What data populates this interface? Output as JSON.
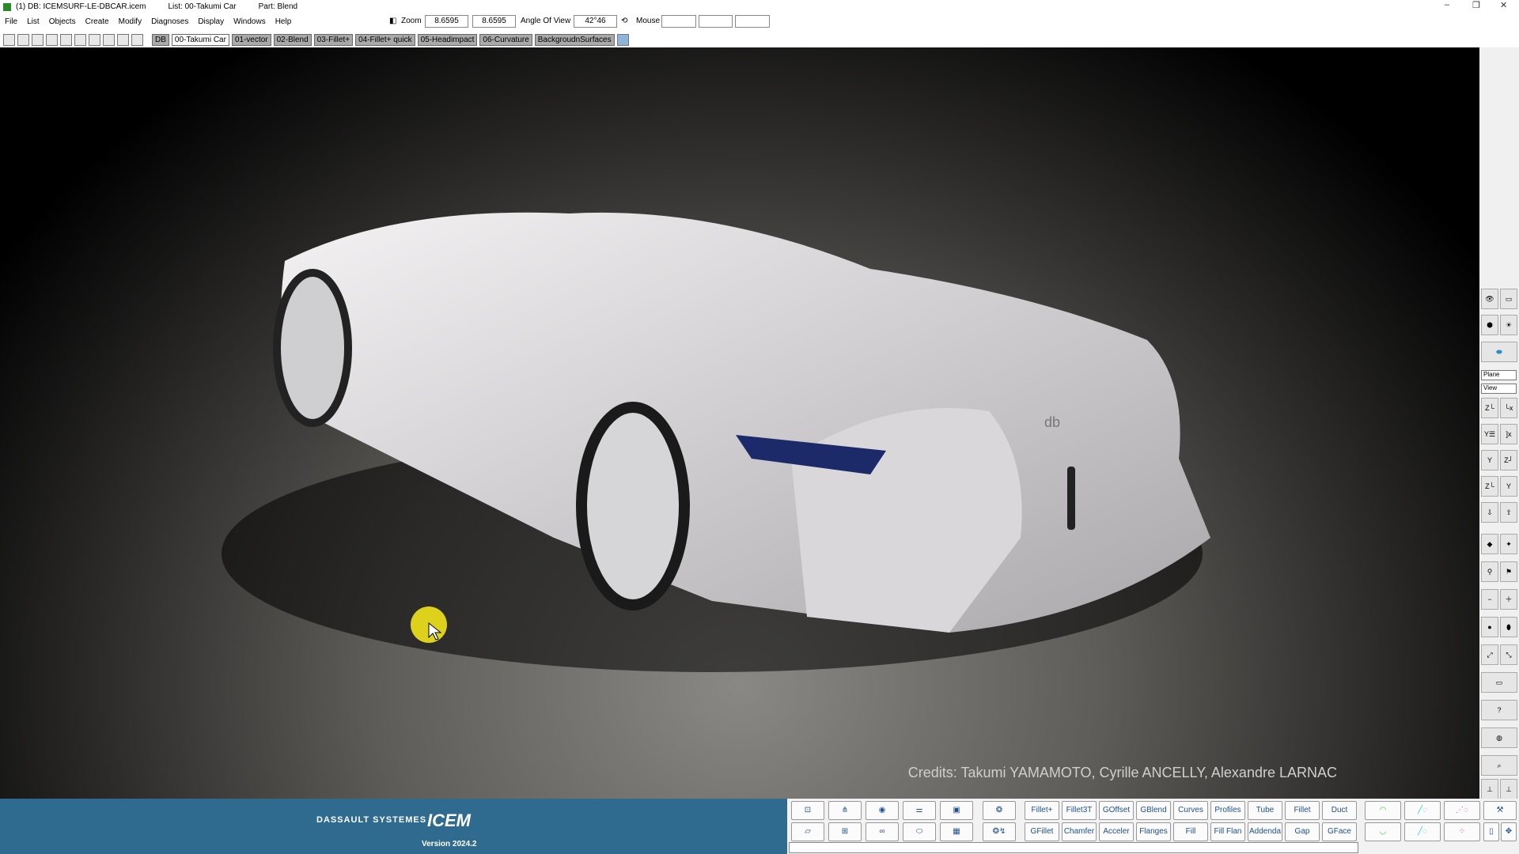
{
  "titlebar": {
    "db": "(1) DB: ICEMSURF-LE-DBCAR.icem",
    "list": "List: 00-Takumi Car",
    "part": "Part: Blend"
  },
  "menu": [
    "File",
    "List",
    "Objects",
    "Create",
    "Modify",
    "Diagnoses",
    "Display",
    "Windows",
    "Help"
  ],
  "view": {
    "zoom_label": "Zoom",
    "zoom_value": "8.6595",
    "zoom_value2": "8.6595",
    "angle_label": "Angle Of View",
    "angle_value": "42°46",
    "mouse_label": "Mouse"
  },
  "tabs": [
    "DB",
    "00-Takumi Car",
    "01-vector",
    "02-Blend",
    "03-Fillet+",
    "04-Fillet+ quick",
    "05-Headimpact",
    "06-Curvature",
    "BackgroudnSurfaces"
  ],
  "active_tab": "00-Takumi Car",
  "viewport": {
    "credits": "Credits: Takumi YAMAMOTO, Cyrille ANCELLY, Alexandre LARNAC",
    "badge": "db"
  },
  "rightbar": {
    "plane_select": "Plane",
    "view_select": "View"
  },
  "branding": {
    "company": "DASSAULT SYSTEMES",
    "product": "ICEM",
    "version": "Version 2024.2"
  },
  "buttons_row1": [
    "Fillet+",
    "Fillet3T",
    "GOffset",
    "GBlend",
    "Curves",
    "Profiles",
    "Tube",
    "Fillet",
    "Duct"
  ],
  "buttons_row2": [
    "GFillet",
    "Chamfer",
    "Acceler",
    "Flanges",
    "Fill",
    "Fill Flan",
    "Addenda",
    "Gap",
    "GFace"
  ],
  "colors": {
    "brand_panel": "#2f6a8f",
    "button_text": "#1f4f8f",
    "cursor_highlight": "#f2e31a"
  }
}
